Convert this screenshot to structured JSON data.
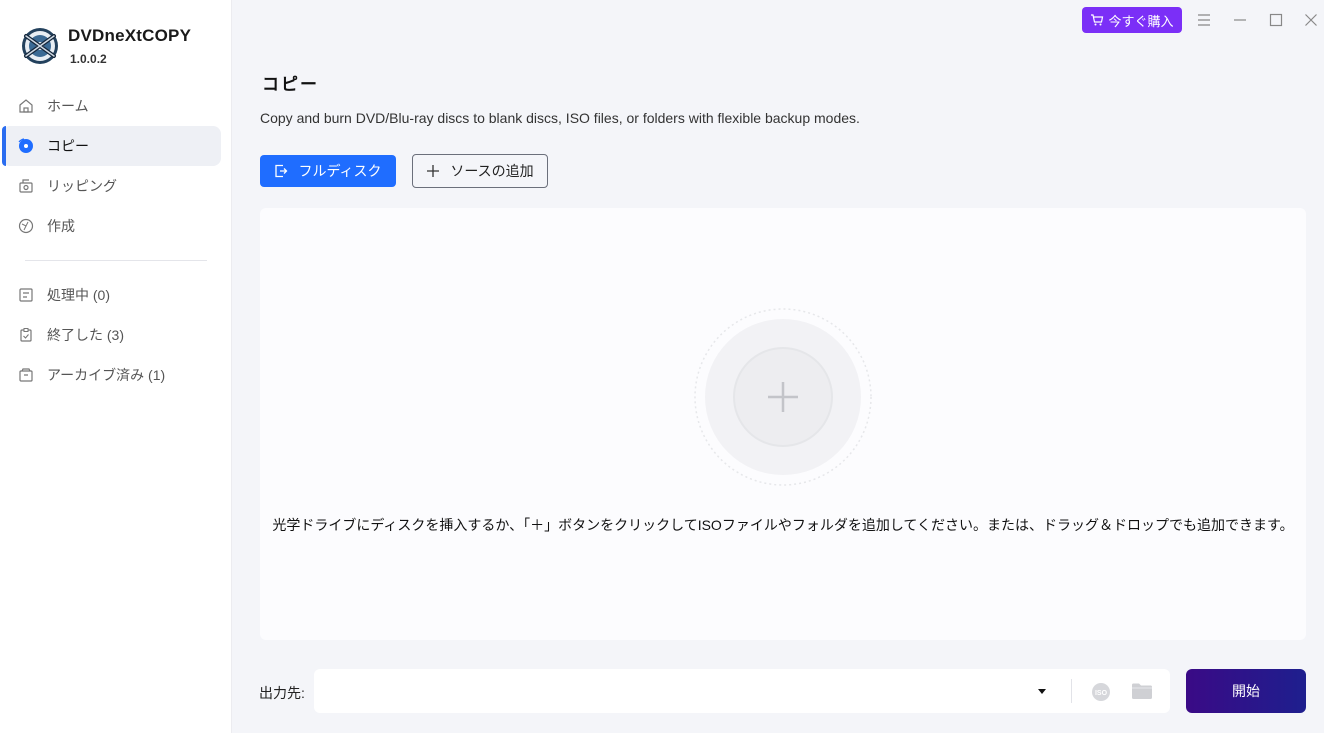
{
  "app": {
    "name": "DVDneXtCOPY",
    "version": "1.0.0.2"
  },
  "titlebar": {
    "buy_label": "今すぐ購入"
  },
  "sidebar": {
    "items": [
      {
        "label": "ホーム",
        "icon": "home-icon"
      },
      {
        "label": "コピー",
        "icon": "disc-icon",
        "active": true
      },
      {
        "label": "リッピング",
        "icon": "rip-icon"
      },
      {
        "label": "作成",
        "icon": "create-icon"
      }
    ],
    "queue": [
      {
        "label": "処理中 (0)",
        "icon": "processing-icon"
      },
      {
        "label": "終了した (3)",
        "icon": "finished-icon"
      },
      {
        "label": "アーカイブ済み (1)",
        "icon": "archive-icon"
      }
    ]
  },
  "main": {
    "title": "コピー",
    "description": "Copy and burn DVD/Blu-ray discs to blank discs, ISO files, or folders with flexible backup modes.",
    "mode_button": "フルディスク",
    "add_source_button": "ソースの追加",
    "drop_hint": "光学ドライブにディスクを挿入するか、「＋」ボタンをクリックしてISOファイルやフォルダを追加してください。または、ドラッグ＆ドロップでも追加できます。"
  },
  "output": {
    "label": "出力先:",
    "value": "",
    "iso_text": "ISO"
  },
  "start_button": "開始",
  "colors": {
    "accent": "#1f6dff",
    "buy": "#7b2ff7",
    "start_from": "#3a0a86",
    "start_to": "#1e1f8e"
  }
}
